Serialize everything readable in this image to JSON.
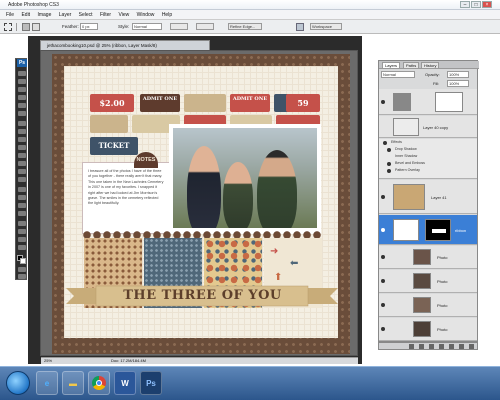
{
  "window": {
    "title": "Adobe Photoshop CS3",
    "controls": [
      "–",
      "□",
      "×"
    ]
  },
  "menu": [
    "File",
    "Edit",
    "Image",
    "Layer",
    "Select",
    "Filter",
    "View",
    "Window",
    "Help"
  ],
  "options_bar": {
    "feather_label": "Feather:",
    "feather_value": "0 px",
    "style_label": "Style:",
    "style_value": "Normal",
    "refine_label": "Refine Edge...",
    "workspace_label": "Workspace"
  },
  "document": {
    "tab_title": "jethacombooking10.psd @ 25% (ribbon, Layer Mask/8)",
    "zoom": "25%",
    "doc_size": "Doc: 17.2M/184.4M"
  },
  "layout": {
    "tickets": [
      "$2.00",
      "ADMIT ONE",
      "ADMIT ONE",
      "59",
      "TICKET"
    ],
    "notes_badge": "NOTES",
    "notes_text": "I treasure all of the photos I have of the three of you together - there really aren't that many. This one taken in the New Lachnies Cemetery in 2007 is one of my favorites. I snapped it right after we had looked at Jim Morrison's grave. The smiles in the cemetery reflected the light beautifully.",
    "banner_title": "THE THREE OF YOU"
  },
  "panels": {
    "tabs": [
      "Layers",
      "Paths",
      "History"
    ],
    "blend_mode": "Normal",
    "opacity_label": "Opacity:",
    "opacity_value": "100%",
    "fill_label": "Fill:",
    "fill_value": "100%",
    "layers": [
      {
        "name": ""
      },
      {
        "name": "Layer 40 copy"
      },
      {
        "name": "Effects"
      },
      {
        "name": "Drop Shadow"
      },
      {
        "name": "Inner Shadow"
      },
      {
        "name": "Bevel and Emboss"
      },
      {
        "name": "Pattern Overlay"
      },
      {
        "name": "Layer 41"
      },
      {
        "name": "ribbon"
      },
      {
        "name": "Photo"
      },
      {
        "name": "Photo"
      },
      {
        "name": "Photo"
      },
      {
        "name": "Photo"
      }
    ]
  },
  "taskbar": {
    "apps": [
      "IE",
      "Explorer",
      "Chrome",
      "Word",
      "Ps"
    ]
  },
  "colors": {
    "accent": "#1c61a8",
    "board": "#6a4d3a",
    "ticket_red": "#c5514a",
    "ticket_tan": "#cbb48c",
    "ticket_navy": "#3f5368"
  }
}
